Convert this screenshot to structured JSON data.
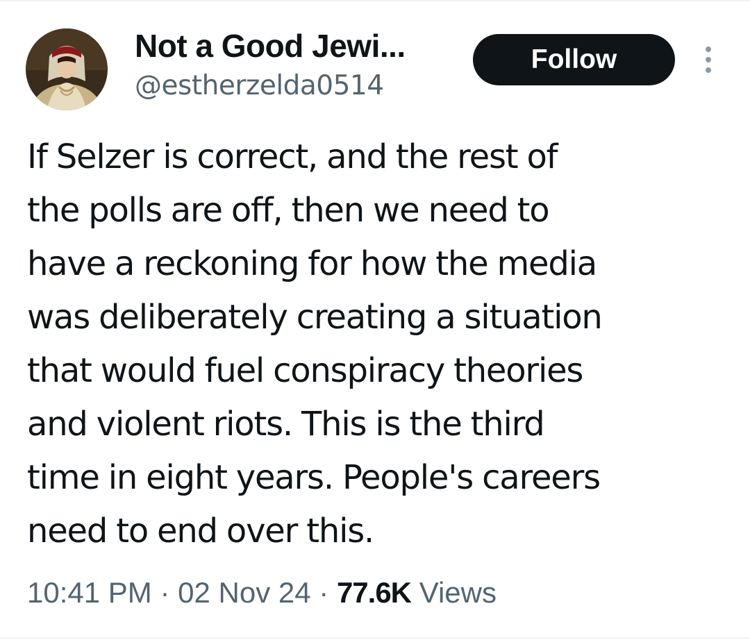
{
  "author": {
    "display_name": "Not a Good Jewi...",
    "handle": "@estherzelda0514"
  },
  "follow_label": "Follow",
  "tweet": {
    "text": "If Selzer is correct, and the rest of\nthe polls are off, then we need to\nhave a reckoning for how the media\nwas deliberately creating a situation\nthat would fuel conspiracy theories\nand violent riots. This is the third\ntime in eight years. People's careers\nneed to end over this."
  },
  "meta": {
    "time": "10:41 PM",
    "separator": "·",
    "date": "02 Nov 24",
    "views_count": "77.6K",
    "views_label": "Views"
  },
  "icons": {
    "more": "more-horizontal-icon"
  }
}
